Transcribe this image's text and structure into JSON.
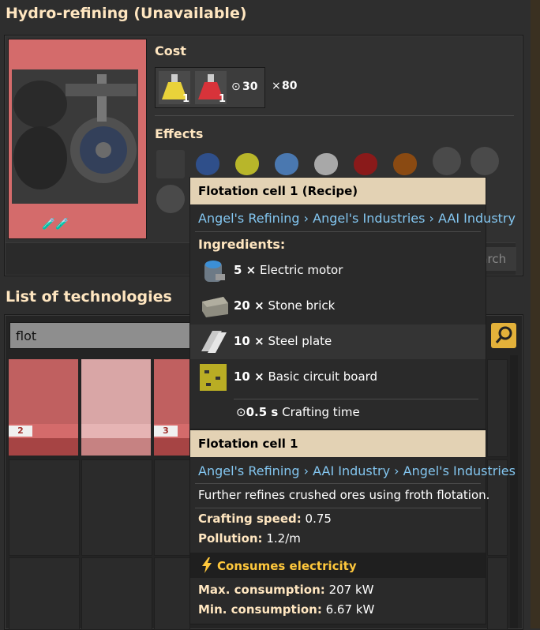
{
  "window": {
    "title": "Hydro-refining (Unavailable)"
  },
  "cost": {
    "label": "Cost",
    "items": [
      {
        "icon": "yellow-science-flask-icon",
        "count": "1"
      },
      {
        "icon": "red-science-flask-icon",
        "count": "1"
      }
    ],
    "time": "30",
    "multiplier": "80"
  },
  "effects": {
    "label": "Effects"
  },
  "search_button": {
    "label": "Start research"
  },
  "tech_list": {
    "title": "List of technologies",
    "search_value": "flot",
    "cards": [
      {
        "level": "2"
      },
      {
        "level": ""
      },
      {
        "level": "3"
      }
    ]
  },
  "tooltip_recipe": {
    "title": "Flotation cell 1 (Recipe)",
    "path": "Angel's Refining › Angel's Industries › AAI Industry",
    "ingredients_label": "Ingredients:",
    "ingredients": [
      {
        "icon": "electric-motor-icon",
        "amount": "5 ×",
        "name": "Electric motor"
      },
      {
        "icon": "stone-brick-icon",
        "amount": "20 ×",
        "name": "Stone brick"
      },
      {
        "icon": "steel-plate-icon",
        "amount": "10 ×",
        "name": "Steel plate"
      },
      {
        "icon": "basic-circuit-board-icon",
        "amount": "10 ×",
        "name": "Basic circuit board"
      }
    ],
    "crafting_time_value": "0.5 s",
    "crafting_time_label": "Crafting time"
  },
  "tooltip_entity": {
    "title": "Flotation cell 1",
    "path": "Angel's Refining › AAI Industry › Angel's Industries",
    "description": "Further refines crushed ores using froth flotation.",
    "crafting_speed_label": "Crafting speed:",
    "crafting_speed_value": "0.75",
    "pollution_label": "Pollution:",
    "pollution_value": "1.2/m",
    "electricity_label": "Consumes electricity",
    "max_label": "Max. consumption:",
    "max_value": "207 kW",
    "min_label": "Min. consumption:",
    "min_value": "6.67 kW"
  },
  "colors": {
    "accent_blue": "#83c6f0",
    "header_beige": "#e3d2b4",
    "unavailable_red": "#d46b6b",
    "electric_yellow": "#ffc83c"
  }
}
